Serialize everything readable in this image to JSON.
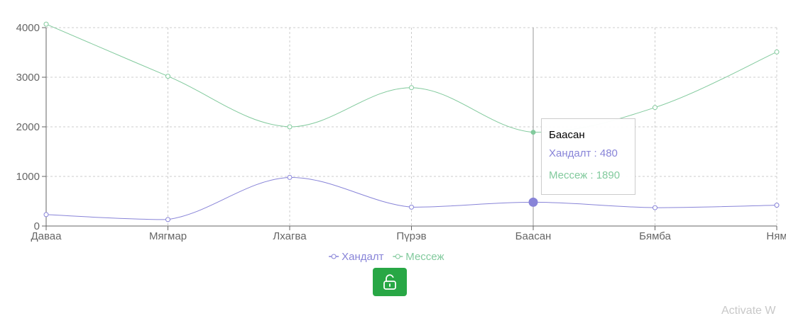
{
  "chart_data": {
    "type": "line",
    "categories": [
      "Даваа",
      "Мягмар",
      "Лхагва",
      "Пүрэв",
      "Баасан",
      "Бямба",
      "Ням"
    ],
    "series": [
      {
        "name": "Хандалт",
        "color": "#8884d8",
        "values": [
          230,
          130,
          980,
          380,
          480,
          370,
          420
        ]
      },
      {
        "name": "Мессеж",
        "color": "#82ca9d",
        "values": [
          4070,
          3020,
          2000,
          2790,
          1890,
          2390,
          3510
        ]
      }
    ],
    "ylim": [
      0,
      4000
    ],
    "yticks": [
      0,
      1000,
      2000,
      3000,
      4000
    ],
    "grid": true,
    "legend": "bottom-center",
    "active_index": 4
  },
  "tooltip": {
    "title": "Баасан",
    "rows": [
      {
        "label": "Хандалт : 480",
        "color": "#8884d8"
      },
      {
        "label": "Мессеж : 1890",
        "color": "#82ca9d"
      }
    ]
  },
  "lock_button": {
    "icon": "lock-open-icon",
    "color": "#28a745"
  },
  "watermark": {
    "text": "Activate W"
  }
}
